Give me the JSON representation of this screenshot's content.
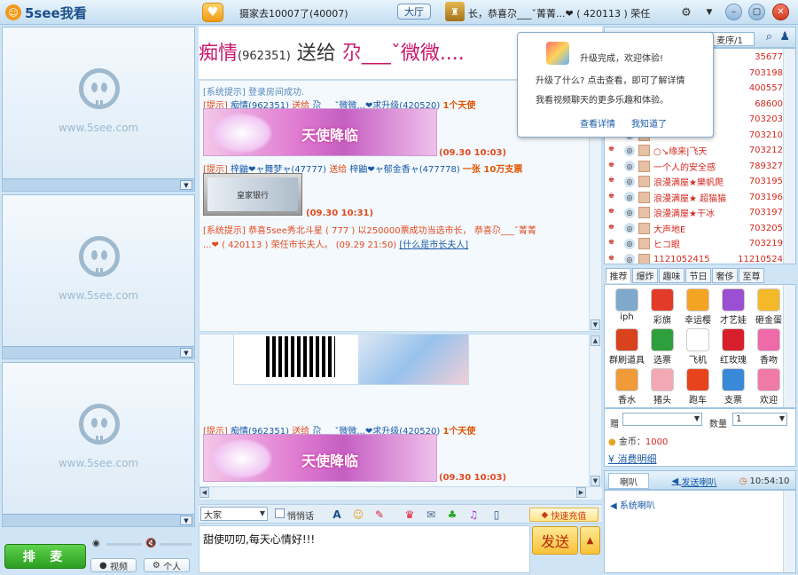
{
  "app": {
    "name": "5see我看"
  },
  "topbar": {
    "ticker": "摄家去10007了(40007)",
    "hall_button": "大厅",
    "room_info": "长，恭喜尕___ˇ菁菁...❤ ( 420113 ) 荣任"
  },
  "videos": [
    {
      "watermark": "www.5see.com"
    },
    {
      "watermark": "www.5see.com"
    },
    {
      "watermark": "www.5see.com"
    }
  ],
  "left_controls": {
    "mic_button": "排 麦",
    "video_button": "视频",
    "personal_button": "个人"
  },
  "banner": {
    "sender": "痴情",
    "sender_id": "(962351)",
    "verb": "送给",
    "receiver": "尕___ˇ微微...."
  },
  "chat": {
    "line1": "[系统提示]  登录房间成功.",
    "line2_tag": "[提示]",
    "line2_nick": "痴情(962351)",
    "line2_verb": "送给",
    "line2_target": "尕___ˇ微微...❤求升级(420520)",
    "line2_qty": "1个天使",
    "angel_label": "天使降临",
    "time1": "(09.30 10:03)",
    "line3_tag": "[提示]",
    "line3_nick": "梓鼬❤ャ舞梦ャ(47777)",
    "line3_verb": "送给",
    "line3_target": "梓鼬❤ャ郁金香ャ(477778)",
    "line3_qty": "一张 10万支票",
    "card_label": "皇家银行",
    "time2": "(09.30 10:31)",
    "line4": "[系统提示] 恭喜5see秀北斗星 ( 777 ) 以250000票成功当选市长， 恭喜尕___ˇ菁菁",
    "line5": "...❤ ( 420113 ) 荣任市长夫人。 (09.29 21:50)",
    "line5_link": "[什么是市长夫人]",
    "line6_tag": "[提示]",
    "line6_nick": "痴情(962351)",
    "line6_verb": "送给",
    "line6_target": "尕___ˇ微微...❤求升级(420520)",
    "line6_qty": "1个天使",
    "angel_label2": "天使降临",
    "time3": "(09.30 10:03)"
  },
  "toolbar": {
    "target_select": "大家",
    "whisper_label": "悄悄话",
    "recharge": "快速充值"
  },
  "input": {
    "text": "甜使叨叨,每天心情好!!!",
    "send_label": "发送"
  },
  "popup": {
    "title": "升级完成，欢迎体验!",
    "body1": "升级了什么? 点击查看，即可了解详情",
    "body2": "我看视频聊天的更多乐趣和体验。",
    "view_link": "查看详情",
    "ok_link": "我知道了"
  },
  "userlist": {
    "tab": "麦序/1",
    "users": [
      {
        "name": "",
        "id": "35677"
      },
      {
        "name": "",
        "id": "703198"
      },
      {
        "name": "",
        "id": "400557"
      },
      {
        "name": "",
        "id": "68600"
      },
      {
        "name": "的",
        "id": "703203"
      },
      {
        "name": "",
        "id": "703210"
      },
      {
        "name": "○↘缘来|飞天",
        "id": "703212"
      },
      {
        "name": "一个人的安全感",
        "id": "789327"
      },
      {
        "name": "浪漫满屋★樂帆爬",
        "id": "703195"
      },
      {
        "name": "浪漫满屋★ 超猫猫",
        "id": "703196"
      },
      {
        "name": "浪漫满屋★干冰",
        "id": "703197"
      },
      {
        "name": "大声地E",
        "id": "703205"
      },
      {
        "name": "ヒコ眼",
        "id": "703219"
      },
      {
        "name": "1121052415",
        "id": "11210524"
      }
    ]
  },
  "gifts": {
    "tabs": [
      "推荐",
      "爆炸",
      "趣味",
      "节日",
      "奢侈",
      "至尊"
    ],
    "items": [
      {
        "label": "iph",
        "color": "#7ea8cc"
      },
      {
        "label": "彩旗",
        "color": "#e33b2a"
      },
      {
        "label": "幸运樱",
        "color": "#f3a423"
      },
      {
        "label": "才艺娃",
        "color": "#9b4fd1"
      },
      {
        "label": "砸金蛋",
        "color": "#f4b82b"
      },
      {
        "label": "群刷道具",
        "color": "#d8421c"
      },
      {
        "label": "选票",
        "color": "#2f9e3c"
      },
      {
        "label": "飞机",
        "color": "#ffffff"
      },
      {
        "label": "红玫瑰",
        "color": "#d61f2a"
      },
      {
        "label": "香吻",
        "color": "#ee6aa8"
      },
      {
        "label": "香水",
        "color": "#f09a3a"
      },
      {
        "label": "猪头",
        "color": "#f2a9b4"
      },
      {
        "label": "跑车",
        "color": "#e7441d"
      },
      {
        "label": "支票",
        "color": "#3a88d8"
      },
      {
        "label": "欢迎",
        "color": "#f07aa6"
      }
    ],
    "to_label": "赠",
    "qty_label": "数量",
    "qty_value": "1",
    "coin_label": "金币：",
    "coin_value": "1000",
    "detail_link": "消费明细"
  },
  "bottom_tabs": {
    "tab1": "喇叭",
    "tab2": "发送喇叭",
    "clock": "10:54:10",
    "row": "系统喇叭"
  }
}
